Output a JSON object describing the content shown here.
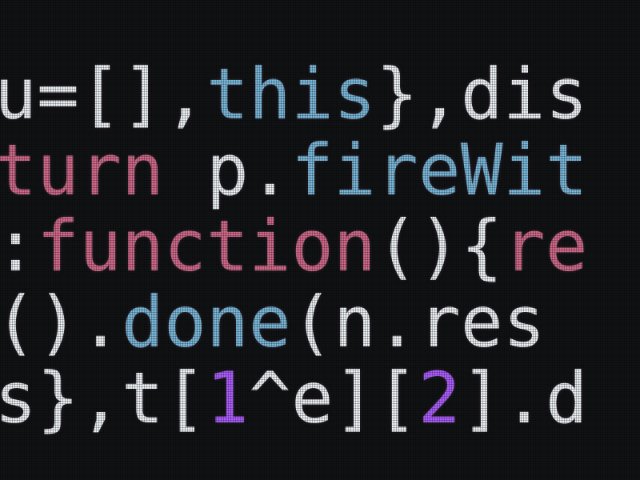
{
  "code": {
    "lines": [
      {
        "tokens": [
          {
            "c": "w",
            "t": " u="
          },
          {
            "c": "w",
            "t": "[]"
          },
          {
            "c": "w",
            "t": ","
          },
          {
            "c": "k",
            "t": "this"
          },
          {
            "c": "w",
            "t": "},"
          },
          {
            "c": "w",
            "t": "dis"
          }
        ]
      },
      {
        "tokens": [
          {
            "c": "r",
            "t": "eturn"
          },
          {
            "c": "w",
            "t": " p."
          },
          {
            "c": "k",
            "t": "fireWit"
          }
        ]
      },
      {
        "tokens": [
          {
            "c": "w",
            "t": "e:"
          },
          {
            "c": "r",
            "t": "function"
          },
          {
            "c": "w",
            "t": "(){"
          },
          {
            "c": "r",
            "t": "re"
          }
        ]
      },
      {
        "tokens": [
          {
            "c": "w",
            "t": "e()."
          },
          {
            "c": "k",
            "t": "done"
          },
          {
            "c": "w",
            "t": "(n.res"
          }
        ]
      },
      {
        "tokens": [
          {
            "c": "w",
            "t": "=s},t["
          },
          {
            "c": "n",
            "t": "1"
          },
          {
            "c": "w",
            "t": "^e]["
          },
          {
            "c": "n",
            "t": "2"
          },
          {
            "c": "w",
            "t": "].d"
          }
        ]
      }
    ]
  }
}
